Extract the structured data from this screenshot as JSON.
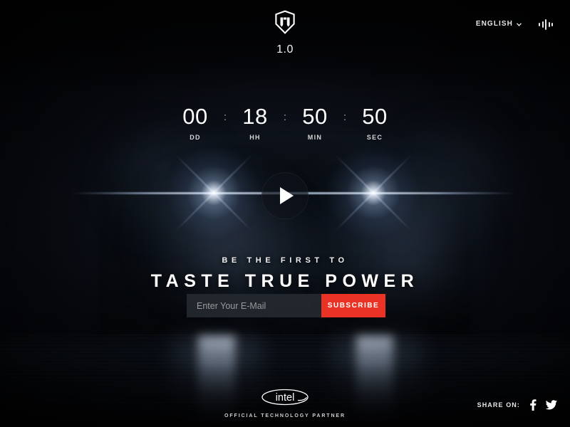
{
  "header": {
    "logo_icon": "wot-shield-icon",
    "version": "1.0",
    "language": "ENGLISH",
    "language_chevron_icon": "chevron-down-icon",
    "sound_icon": "sound-equalizer-icon"
  },
  "countdown": {
    "separator": ":",
    "units": [
      {
        "value": "00",
        "label": "DD"
      },
      {
        "value": "18",
        "label": "HH"
      },
      {
        "value": "50",
        "label": "MIN"
      },
      {
        "value": "50",
        "label": "SEC"
      }
    ]
  },
  "video": {
    "play_icon": "play-icon"
  },
  "headline": {
    "kicker": "BE THE FIRST TO",
    "title": "TASTE TRUE POWER"
  },
  "subscribe": {
    "email_placeholder": "Enter Your E-Mail",
    "email_value": "",
    "button_label": "SUBSCRIBE",
    "button_color": "#ea3324"
  },
  "footer": {
    "partner_logo": "intel-logo",
    "partner_logo_text": "intel",
    "partner_text": "OFFICIAL TECHNOLOGY PARTNER",
    "share_label": "SHARE ON:",
    "share_icons": [
      {
        "name": "facebook-icon"
      },
      {
        "name": "twitter-icon"
      }
    ]
  }
}
